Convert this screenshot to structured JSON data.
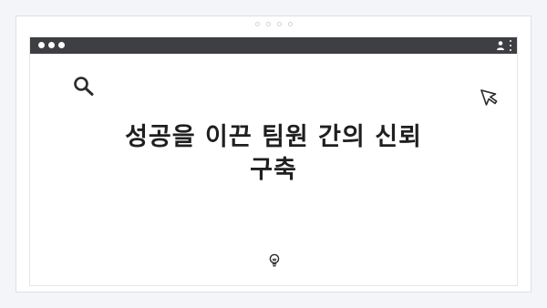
{
  "headline": {
    "line1": "성공을 이끈 팀원 간의 신뢰",
    "line2": "구축"
  },
  "icons": {
    "search": "search-icon",
    "cursor": "cursor-pointer-icon",
    "profile": "user-profile-icon",
    "menu": "more-vertical-icon",
    "bulb": "lightbulb-icon"
  },
  "colors": {
    "titlebar": "#3e3f43",
    "page_background": "#f4f5f8",
    "headline": "#1f1f1f"
  }
}
